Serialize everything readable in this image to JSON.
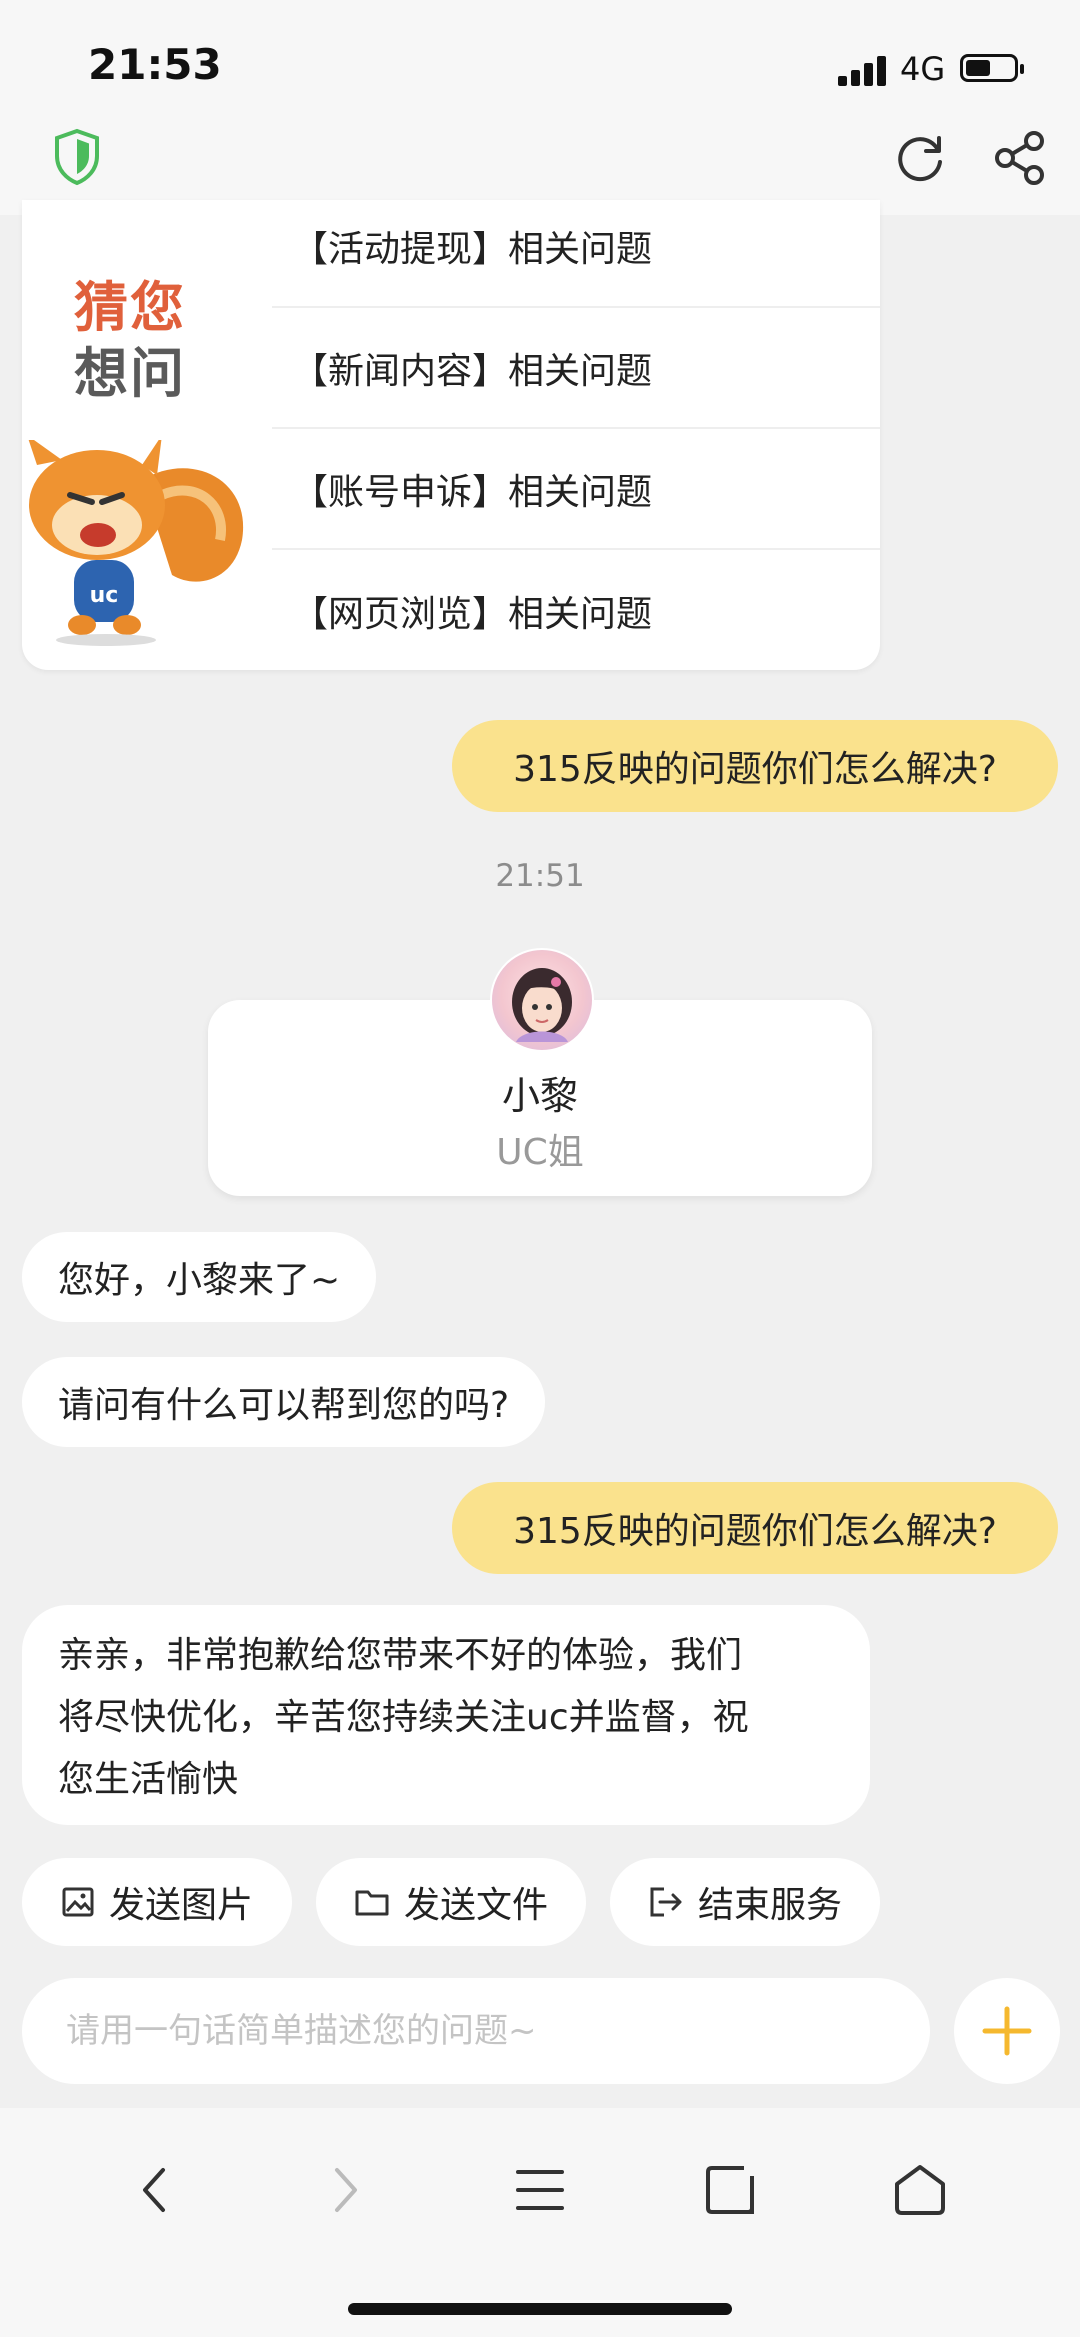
{
  "status_bar": {
    "time": "21:53",
    "network": "4G"
  },
  "guess_card": {
    "title_line1": "猜您",
    "title_line2": "想问",
    "faq_items": [
      "【活动提现】相关问题",
      "【新闻内容】相关问题",
      "【账号申诉】相关问题",
      "【网页浏览】相关问题"
    ]
  },
  "messages": {
    "user_msg_1": "315反映的问题你们怎么解决?",
    "timestamp": "21:51",
    "agent_name": "小黎",
    "agent_role": "UC姐",
    "agent_greeting": "您好，小黎来了~",
    "agent_question": "请问有什么可以帮到您的吗?",
    "user_msg_2": "315反映的问题你们怎么解决?",
    "agent_reply_line1": "亲亲，非常抱歉给您带来不好的体验，我们",
    "agent_reply_line2": "将尽快优化，辛苦您持续关注uc并监督，祝",
    "agent_reply_line3": "您生活愉快"
  },
  "actions": {
    "send_image": "发送图片",
    "send_file": "发送文件",
    "end_service": "结束服务"
  },
  "input": {
    "placeholder": "请用一句话简单描述您的问题~"
  },
  "colors": {
    "accent": "#f5b82e",
    "user_bubble": "#fae28d",
    "shield": "#4cbb5c"
  },
  "icons": [
    "shield-icon",
    "reload-icon",
    "share-icon",
    "image-icon",
    "folder-icon",
    "exit-icon",
    "plus-icon",
    "back-icon",
    "forward-icon",
    "menu-icon",
    "tabs-icon",
    "home-icon"
  ]
}
